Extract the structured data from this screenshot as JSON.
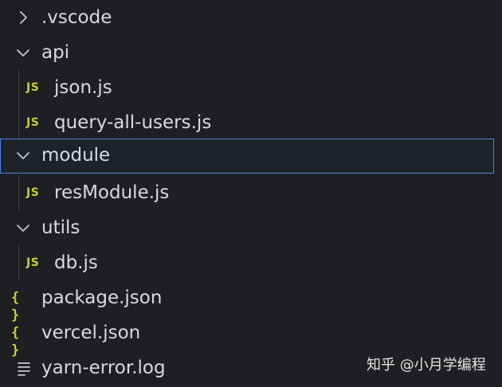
{
  "explorer": {
    "items": [
      {
        "label": ".vscode",
        "kind": "folder",
        "state": "collapsed"
      },
      {
        "label": "api",
        "kind": "folder",
        "state": "expanded"
      },
      {
        "label": "json.js",
        "kind": "file",
        "icon": "JS"
      },
      {
        "label": "query-all-users.js",
        "kind": "file",
        "icon": "JS"
      },
      {
        "label": "module",
        "kind": "folder",
        "state": "expanded",
        "selected": true
      },
      {
        "label": "resModule.js",
        "kind": "file",
        "icon": "JS"
      },
      {
        "label": "utils",
        "kind": "folder",
        "state": "expanded"
      },
      {
        "label": "db.js",
        "kind": "file",
        "icon": "JS"
      },
      {
        "label": "package.json",
        "kind": "file",
        "icon": "{ }"
      },
      {
        "label": "vercel.json",
        "kind": "file",
        "icon": "{ }"
      },
      {
        "label": "yarn-error.log",
        "kind": "file",
        "icon": "log-lines"
      }
    ]
  },
  "watermark": "知乎 @小月学编程",
  "colors": {
    "background": "#1e1f22",
    "text": "#d7dae0",
    "js_icon": "#cbcb41",
    "json_icon": "#cbcb41",
    "selection_border": "#4b7fe0",
    "guide": "#3a3c41"
  }
}
